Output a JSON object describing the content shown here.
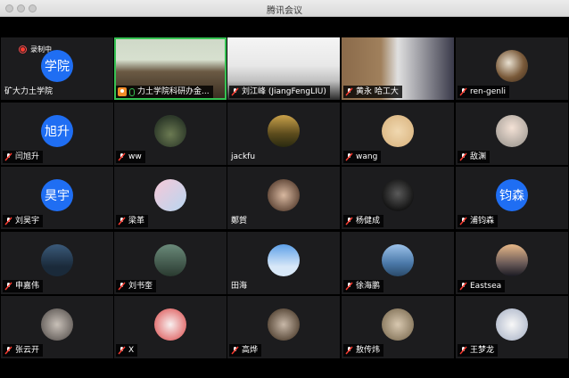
{
  "window": {
    "title": "腾讯会议"
  },
  "recording": {
    "label": "录制中"
  },
  "colors": {
    "accent": "#1f6ef3",
    "active": "#36c253",
    "mic_muted": "#ff3b30"
  },
  "tiles": [
    {
      "name": "矿大力土学院",
      "avatar_text": "学院",
      "type": "text-avatar",
      "tag_style": "plain"
    },
    {
      "name": "力土学院科研办金...",
      "type": "video",
      "active": true
    },
    {
      "name": "刘江峰 (JiangFengLIU)",
      "type": "video"
    },
    {
      "name": "黄永 哈工大",
      "type": "video"
    },
    {
      "name": "ren-genli",
      "type": "photo-avatar",
      "icon": "eagle-photo"
    },
    {
      "name": "闫旭升",
      "avatar_text": "旭升",
      "type": "text-avatar"
    },
    {
      "name": "ww",
      "type": "photo-avatar",
      "icon": "tree-photo"
    },
    {
      "name": "jackfu",
      "type": "photo-avatar",
      "icon": "forest-photo",
      "tag_style": "plain"
    },
    {
      "name": "wang",
      "type": "photo-avatar",
      "icon": "heart-photo"
    },
    {
      "name": "敌渊",
      "type": "photo-avatar",
      "icon": "child-photo"
    },
    {
      "name": "刘昊宇",
      "avatar_text": "昊宇",
      "type": "text-avatar"
    },
    {
      "name": "梁革",
      "type": "photo-avatar",
      "icon": "anime-photo"
    },
    {
      "name": "鄭賀",
      "type": "photo-avatar",
      "icon": "couple-photo",
      "tag_style": "plain"
    },
    {
      "name": "杨健成",
      "type": "photo-avatar",
      "icon": "portrait-photo"
    },
    {
      "name": "浦钧森",
      "avatar_text": "钧森",
      "type": "text-avatar"
    },
    {
      "name": "申嘉伟",
      "type": "photo-avatar",
      "icon": "road-photo"
    },
    {
      "name": "刘书奎",
      "type": "photo-avatar",
      "icon": "person-photo"
    },
    {
      "name": "田海",
      "type": "photo-avatar",
      "icon": "sky-photo",
      "tag_style": "plain"
    },
    {
      "name": "徐海鹏",
      "type": "photo-avatar",
      "icon": "lake-photo"
    },
    {
      "name": "Eastsea",
      "type": "photo-avatar",
      "icon": "city-photo"
    },
    {
      "name": "张云开",
      "type": "photo-avatar",
      "icon": "sketch-photo"
    },
    {
      "name": "X",
      "type": "photo-avatar",
      "icon": "cartoon-photo"
    },
    {
      "name": "高烨",
      "type": "photo-avatar",
      "icon": "dog-photo"
    },
    {
      "name": "敖传炜",
      "type": "photo-avatar",
      "icon": "hedgehog-photo"
    },
    {
      "name": "王梦龙",
      "type": "photo-avatar",
      "icon": "anime-girl-photo"
    }
  ]
}
